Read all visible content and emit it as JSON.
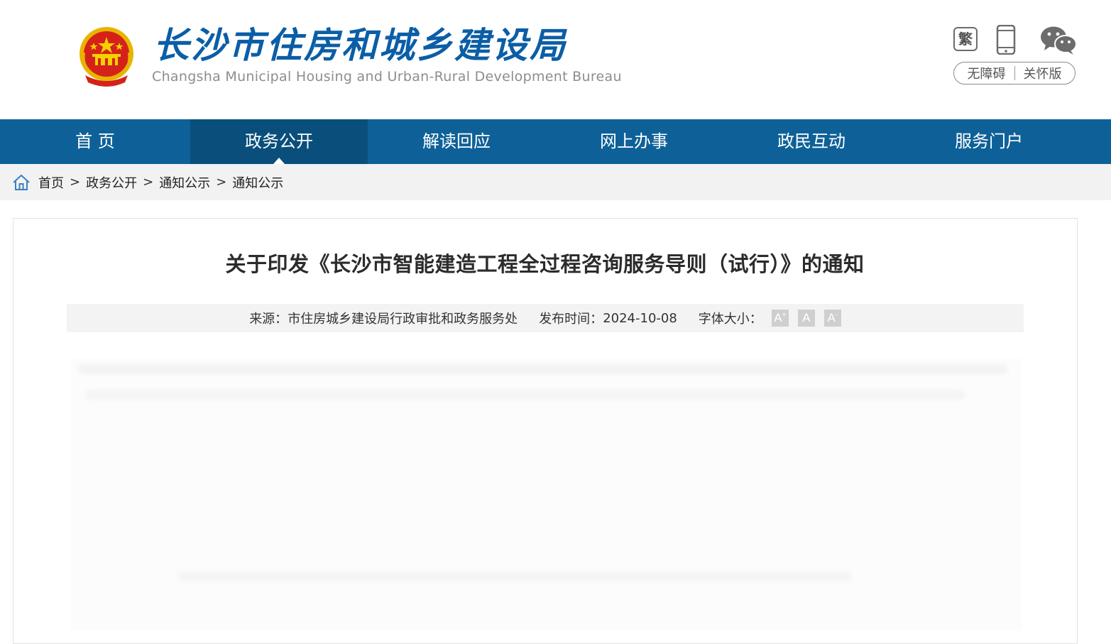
{
  "header": {
    "title_cn": "长沙市住房和城乡建设局",
    "title_en": "Changsha Municipal Housing and Urban-Rural Development Bureau",
    "emblem_icon": "national-emblem-icon",
    "tools": {
      "traditional_label": "繁",
      "mobile_icon": "mobile-phone-icon",
      "wechat_icon": "wechat-icon",
      "accessibility_label": "无障碍",
      "care_label": "关怀版"
    }
  },
  "nav": {
    "items": [
      "首  页",
      "政务公开",
      "解读回应",
      "网上办事",
      "政民互动",
      "服务门户"
    ],
    "active": "政务公开"
  },
  "breadcrumb": {
    "home_icon": "home-icon",
    "items": [
      "首页",
      "政务公开",
      "通知公示",
      "通知公示"
    ],
    "separator": ">"
  },
  "article": {
    "title": "关于印发《长沙市智能建造工程全过程咨询服务导则（试行）》的通知",
    "meta": {
      "source_label": "来源：",
      "source_value": "市住房城乡建设局行政审批和政务服务处",
      "date_label": "发布时间：",
      "date_value": "2024-10-08",
      "font_size_label": "字体大小：",
      "font_buttons": [
        "A",
        "A",
        "A"
      ]
    }
  },
  "colors": {
    "brand_blue": "#0e6198",
    "nav_active": "#0a4f7c",
    "title_blue": "#0b5ea6",
    "breadcrumb_bg": "#f2f2f2"
  }
}
